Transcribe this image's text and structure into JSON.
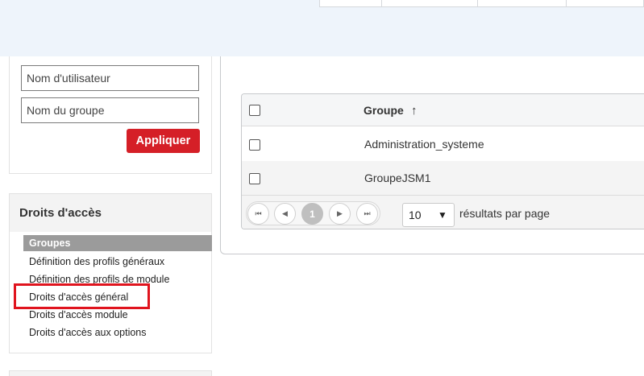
{
  "filters": {
    "username_placeholder": "Nom d'utilisateur",
    "group_placeholder": "Nom du groupe",
    "apply_label": "Appliquer"
  },
  "access_rights": {
    "title": "Droits d'accès",
    "items": [
      "Groupes",
      "Définition des profils généraux",
      "Définition des profils de module",
      "Droits d'accès général",
      "Droits d'accès module",
      "Droits d'accès aux options"
    ],
    "active_item": "Groupes",
    "highlighted_item": "Droits d'accès général"
  },
  "grid": {
    "column_header": "Groupe",
    "sort_indicator": "↑",
    "rows": [
      "Administration_systeme",
      "GroupeJSM1"
    ]
  },
  "pager": {
    "current_page": "1",
    "first_icon": "⏮",
    "prev_icon": "◀",
    "next_icon": "▶",
    "last_icon": "⏭",
    "page_size": "10",
    "page_size_caret": "▼",
    "per_page_label": "résultats par page"
  },
  "colors": {
    "accent_red": "#d51f27",
    "highlight_red": "#e0141e",
    "active_item_bg": "#9b9b9b",
    "top_band_bg": "#eef4fb"
  }
}
